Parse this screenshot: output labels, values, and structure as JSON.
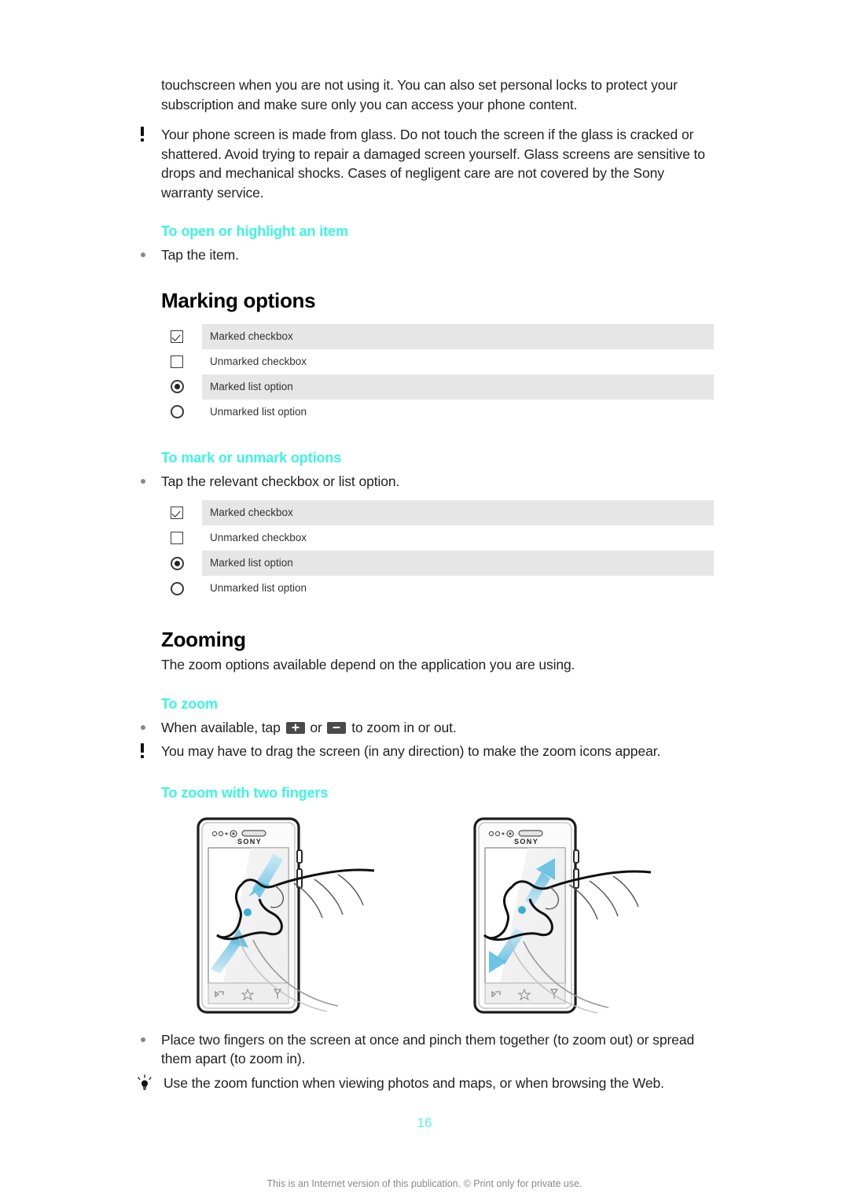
{
  "document": {
    "intro_paragraph": "touchscreen when you are not using it. You can also set personal locks to protect your subscription and make sure only you can access your phone content.",
    "warning_note": "Your phone screen is made from glass. Do not touch the screen if the glass is cracked or shattered. Avoid trying to repair a damaged screen yourself. Glass screens are sensitive to drops and mechanical shocks. Cases of negligent care are not covered by the Sony warranty service."
  },
  "procedures": {
    "open_or_highlight": {
      "heading": "To open or highlight an item",
      "step": "Tap the item."
    },
    "mark_or_unmark": {
      "heading": "To mark or unmark options",
      "step": "Tap the relevant checkbox or list option."
    },
    "to_zoom": {
      "heading": "To zoom",
      "step_prefix": "When available, tap",
      "step_middle": "or",
      "step_suffix": "to zoom in or out.",
      "note": "You may have to drag the screen (in any direction) to make the zoom icons appear."
    },
    "to_zoom_two_fingers": {
      "heading": "To zoom with two fingers",
      "step": "Place two fingers on the screen at once and pinch them together (to zoom out) or spread them apart (to zoom in).",
      "tip": "Use the zoom function when viewing photos and maps, or when browsing the Web."
    }
  },
  "sections": {
    "marking_options": {
      "title": "Marking options"
    },
    "zooming": {
      "title": "Zooming",
      "intro": "The zoom options available depend on the application you are using."
    }
  },
  "marking_table": {
    "rows": [
      {
        "label": "Marked checkbox",
        "icon": "checkbox-checked",
        "shaded": true
      },
      {
        "label": "Unmarked checkbox",
        "icon": "checkbox-unchecked",
        "shaded": false
      },
      {
        "label": "Marked list option",
        "icon": "radio-checked",
        "shaded": true
      },
      {
        "label": "Unmarked list option",
        "icon": "radio-unchecked",
        "shaded": false
      }
    ]
  },
  "illustration": {
    "left_phone": {
      "brand": "SONY",
      "gesture": "pinch-together-zoom-out"
    },
    "right_phone": {
      "brand": "SONY",
      "gesture": "spread-apart-zoom-in"
    }
  },
  "footer": {
    "page_number": "16",
    "notice": "This is an Internet version of this publication. © Print only for private use."
  },
  "colors": {
    "accent_cyan": "#3cf5e0",
    "row_shade": "#e6e6e6",
    "body_text": "#222222",
    "footer_text": "#8a8a8a",
    "arrow_blue": "#6ec6e8"
  }
}
